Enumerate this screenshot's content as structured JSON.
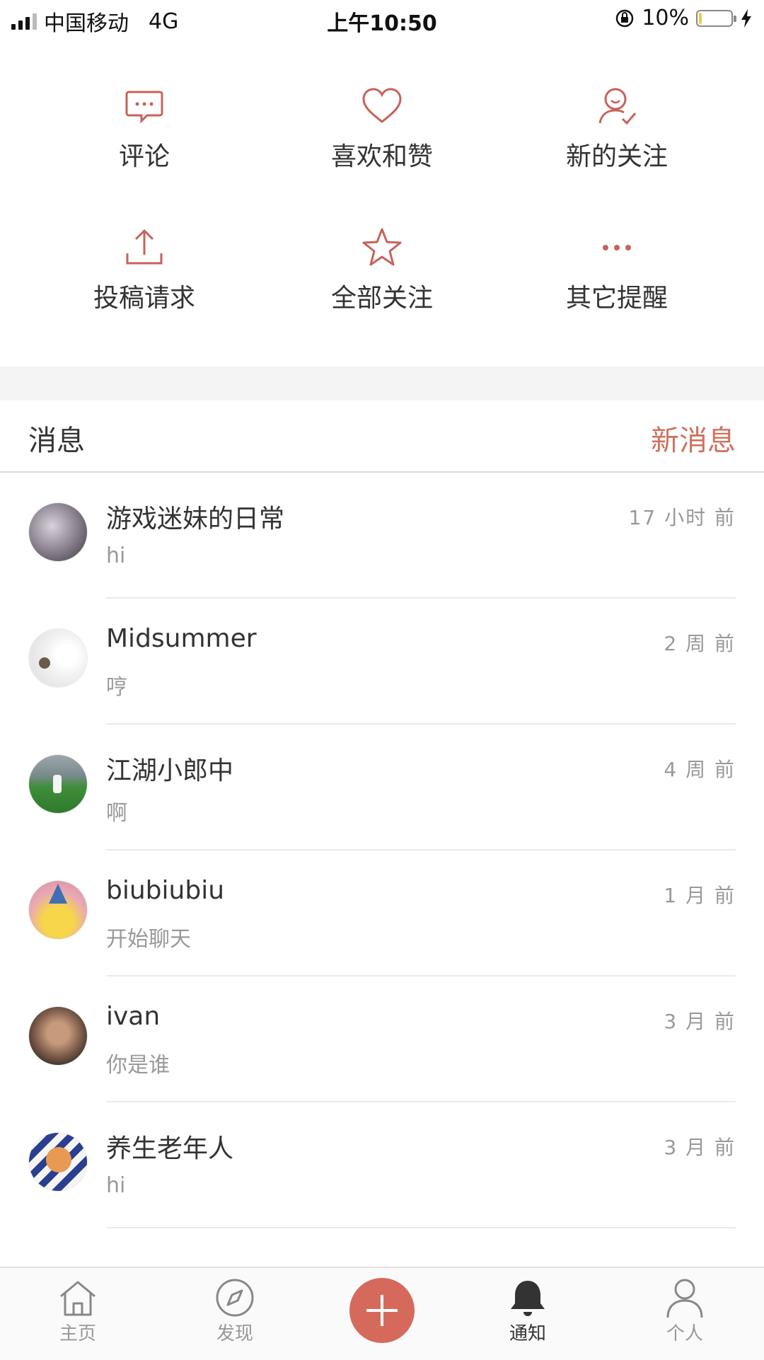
{
  "status_bar": {
    "carrier": "中国移动",
    "network": "4G",
    "time": "上午10:50",
    "battery": "10%",
    "battery_level": 0.1
  },
  "grid": [
    {
      "label": "评论",
      "icon": "comment-icon"
    },
    {
      "label": "喜欢和赞",
      "icon": "heart-icon"
    },
    {
      "label": "新的关注",
      "icon": "follower-icon"
    },
    {
      "label": "投稿请求",
      "icon": "upload-icon"
    },
    {
      "label": "全部关注",
      "icon": "star-icon"
    },
    {
      "label": "其它提醒",
      "icon": "more-icon"
    }
  ],
  "messages_section": {
    "title": "消息",
    "action": "新消息"
  },
  "messages": [
    {
      "name": "游戏迷妹的日常",
      "text": "hi",
      "time": "17 小时 前"
    },
    {
      "name": "Midsummer",
      "text": "哼",
      "time": "2 周 前"
    },
    {
      "name": "江湖小郎中",
      "text": "啊",
      "time": "4 周 前"
    },
    {
      "name": "biubiubiu",
      "text": "开始聊天",
      "time": "1 月 前"
    },
    {
      "name": "ivan",
      "text": "你是谁",
      "time": "3 月 前"
    },
    {
      "name": "养生老年人",
      "text": "hi",
      "time": "3 月 前"
    }
  ],
  "tab_bar": {
    "home": "主页",
    "discover": "发现",
    "notifications": "通知",
    "profile": "个人",
    "active": "通知"
  },
  "colors": {
    "accent": "#d0705e",
    "add_button": "#d56a5c"
  }
}
